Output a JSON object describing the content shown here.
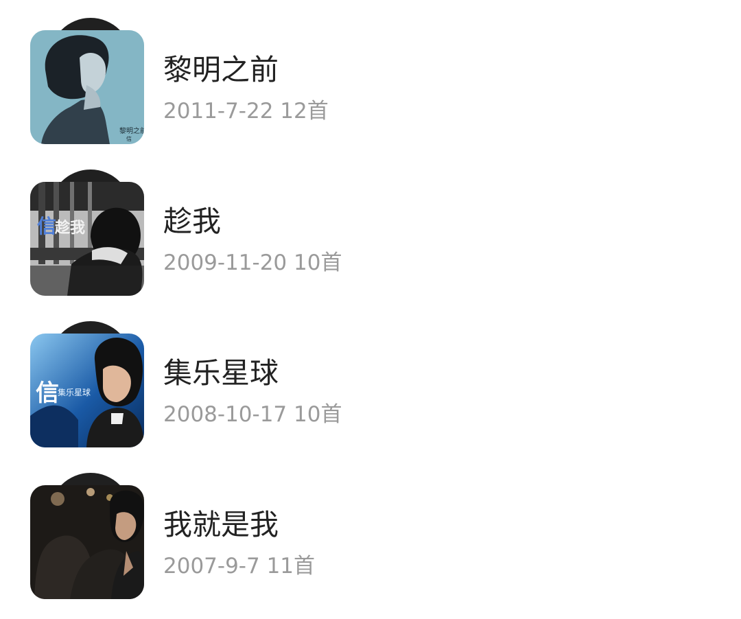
{
  "albums": [
    {
      "title": "黎明之前",
      "date": "2011-7-22",
      "count": "12首",
      "cover_text": "黎明之前",
      "cover_sub": "信",
      "cover_colors": [
        "#79aebf",
        "#314c5c"
      ]
    },
    {
      "title": "趁我",
      "date": "2009-11-20",
      "count": "10首",
      "cover_text": "趁我",
      "cover_sub": "信",
      "cover_colors": [
        "#2b2b2b",
        "#d9d9d9"
      ]
    },
    {
      "title": "集乐星球",
      "date": "2008-10-17",
      "count": "10首",
      "cover_text": "集乐星球",
      "cover_sub": "信",
      "cover_colors": [
        "#0e3f80",
        "#8bc7ef"
      ]
    },
    {
      "title": "我就是我",
      "date": "2007-9-7",
      "count": "11首",
      "cover_text": "",
      "cover_sub": "",
      "cover_colors": [
        "#1d1a17",
        "#a98d6b"
      ]
    }
  ],
  "colors": {
    "title": "#222222",
    "meta": "#9a9a9a",
    "vinyl": "#202020",
    "background": "#ffffff"
  }
}
